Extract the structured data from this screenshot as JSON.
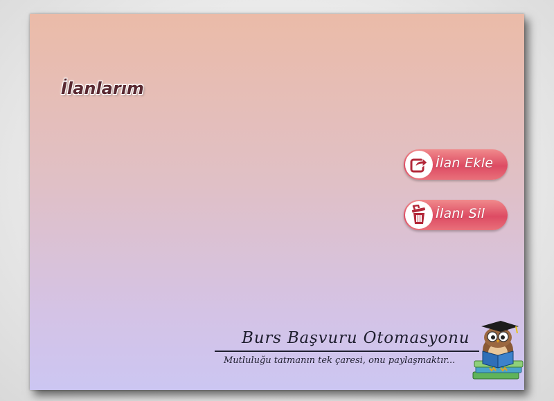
{
  "page": {
    "title": "İlanlarım"
  },
  "actions": {
    "add_label": "İlan Ekle",
    "delete_label": "İlanı Sil",
    "add_icon": "share-arrow-icon",
    "delete_icon": "trash-icon"
  },
  "branding": {
    "title": "Burs Başvuru Otomasyonu",
    "slogan": "Mutluluğu tatmanın tek çaresi, onu paylaşmaktır...",
    "mascot": "owl-reading-book-icon"
  },
  "colors": {
    "button_gradient_top": "#f08a8c",
    "button_gradient_mid": "#dd4b63",
    "icon_color": "#b3293a",
    "background_top": "#ebbba8",
    "background_bottom": "#ccc6f2"
  }
}
